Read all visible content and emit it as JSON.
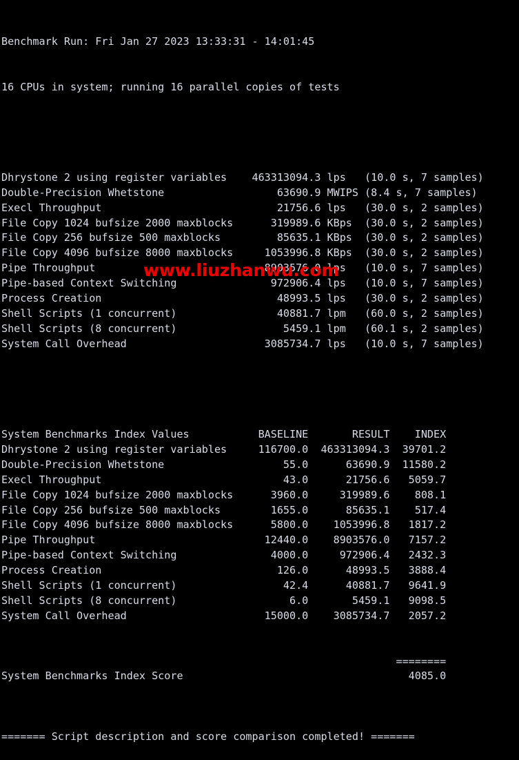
{
  "terminal": {
    "background_color": "#000000",
    "text_color": "#d9dce7",
    "header": {
      "run_line": "Benchmark Run: Fri Jan 27 2023 13:33:31 - 14:01:45",
      "cpu_line": "16 CPUs in system; running 16 parallel copies of tests"
    },
    "raw_results": {
      "rows": [
        {
          "name": "Dhrystone 2 using register variables",
          "value": "463313094.3",
          "unit": "lps",
          "timing": "(10.0 s, 7 samples)"
        },
        {
          "name": "Double-Precision Whetstone",
          "value": "63690.9",
          "unit": "MWIPS",
          "timing": "(8.4 s, 7 samples)"
        },
        {
          "name": "Execl Throughput",
          "value": "21756.6",
          "unit": "lps",
          "timing": "(30.0 s, 2 samples)"
        },
        {
          "name": "File Copy 1024 bufsize 2000 maxblocks",
          "value": "319989.6",
          "unit": "KBps",
          "timing": "(30.0 s, 2 samples)"
        },
        {
          "name": "File Copy 256 bufsize 500 maxblocks",
          "value": "85635.1",
          "unit": "KBps",
          "timing": "(30.0 s, 2 samples)"
        },
        {
          "name": "File Copy 4096 bufsize 8000 maxblocks",
          "value": "1053996.8",
          "unit": "KBps",
          "timing": "(30.0 s, 2 samples)"
        },
        {
          "name": "Pipe Throughput",
          "value": "8903576.0",
          "unit": "lps",
          "timing": "(10.0 s, 7 samples)"
        },
        {
          "name": "Pipe-based Context Switching",
          "value": "972906.4",
          "unit": "lps",
          "timing": "(10.0 s, 7 samples)"
        },
        {
          "name": "Process Creation",
          "value": "48993.5",
          "unit": "lps",
          "timing": "(30.0 s, 2 samples)"
        },
        {
          "name": "Shell Scripts (1 concurrent)",
          "value": "40881.7",
          "unit": "lpm",
          "timing": "(60.0 s, 2 samples)"
        },
        {
          "name": "Shell Scripts (8 concurrent)",
          "value": "5459.1",
          "unit": "lpm",
          "timing": "(60.1 s, 2 samples)"
        },
        {
          "name": "System Call Overhead",
          "value": "3085734.7",
          "unit": "lps",
          "timing": "(10.0 s, 7 samples)"
        }
      ]
    },
    "index_values": {
      "title": "System Benchmarks Index Values",
      "columns": [
        "BASELINE",
        "RESULT",
        "INDEX"
      ],
      "rows": [
        {
          "name": "Dhrystone 2 using register variables",
          "baseline": "116700.0",
          "result": "463313094.3",
          "index": "39701.2"
        },
        {
          "name": "Double-Precision Whetstone",
          "baseline": "55.0",
          "result": "63690.9",
          "index": "11580.2"
        },
        {
          "name": "Execl Throughput",
          "baseline": "43.0",
          "result": "21756.6",
          "index": "5059.7"
        },
        {
          "name": "File Copy 1024 bufsize 2000 maxblocks",
          "baseline": "3960.0",
          "result": "319989.6",
          "index": "808.1"
        },
        {
          "name": "File Copy 256 bufsize 500 maxblocks",
          "baseline": "1655.0",
          "result": "85635.1",
          "index": "517.4"
        },
        {
          "name": "File Copy 4096 bufsize 8000 maxblocks",
          "baseline": "5800.0",
          "result": "1053996.8",
          "index": "1817.2"
        },
        {
          "name": "Pipe Throughput",
          "baseline": "12440.0",
          "result": "8903576.0",
          "index": "7157.2"
        },
        {
          "name": "Pipe-based Context Switching",
          "baseline": "4000.0",
          "result": "972906.4",
          "index": "2432.3"
        },
        {
          "name": "Process Creation",
          "baseline": "126.0",
          "result": "48993.5",
          "index": "3888.4"
        },
        {
          "name": "Shell Scripts (1 concurrent)",
          "baseline": "42.4",
          "result": "40881.7",
          "index": "9641.9"
        },
        {
          "name": "Shell Scripts (8 concurrent)",
          "baseline": "6.0",
          "result": "5459.1",
          "index": "9098.5"
        },
        {
          "name": "System Call Overhead",
          "baseline": "15000.0",
          "result": "3085734.7",
          "index": "2057.2"
        }
      ],
      "separator": "========",
      "score_label": "System Benchmarks Index Score",
      "score_value": "4085.0"
    },
    "footer": {
      "text": "======= Script description and score comparison completed! ======="
    }
  },
  "watermark": {
    "text": "www.liuzhanwu.com",
    "color": "#ee0000"
  }
}
